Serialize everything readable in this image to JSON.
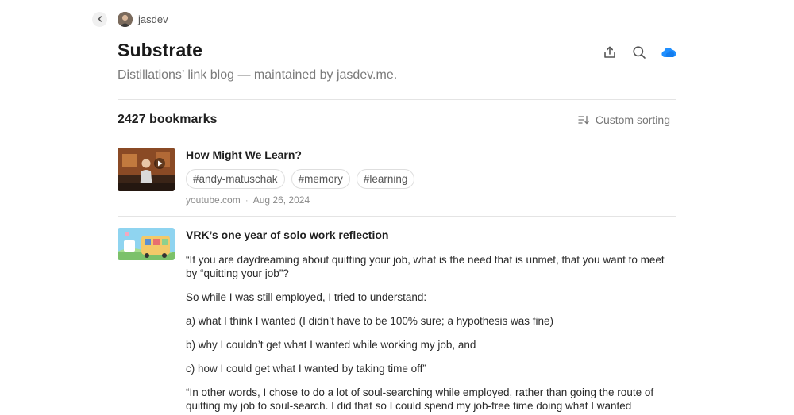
{
  "owner": {
    "name": "jasdev"
  },
  "collection": {
    "title": "Substrate",
    "subtitle": "Distillations’ link blog — maintained by jasdev.me."
  },
  "toolbar": {
    "count_label": "2427 bookmarks",
    "sort_label": "Custom sorting"
  },
  "icons": {
    "back": "chevron-left-icon",
    "share": "share-icon",
    "search": "search-icon",
    "cloud": "cloud-icon"
  },
  "colors": {
    "cloud": "#1f8fff",
    "cloud_dark": "#0b6fe0"
  },
  "bookmarks": [
    {
      "title": "How Might We Learn?",
      "tags": [
        "#andy-matuschak",
        "#memory",
        "#learning"
      ],
      "domain": "youtube.com",
      "separator": "·",
      "date": "Aug 26, 2024"
    },
    {
      "title": "VRK’s one year of solo work reflection",
      "paragraphs": [
        "“If you are daydreaming about quitting your job, what is the need that is unmet, that you want to meet by “quitting your job”?",
        "So while I was still employed, I tried to understand:",
        "a) what I think I wanted (I didn’t have to be 100% sure; a hypothesis was fine)",
        "b) why I couldn’t get what I wanted while working my job, and",
        "c) how I could get what I wanted by taking time off”",
        "“In other words, I chose to do a lot of soul-searching while employed, rather than going the route of quitting my job to soul-search. I did that so I could spend my job-free time doing what I wanted"
      ]
    }
  ]
}
